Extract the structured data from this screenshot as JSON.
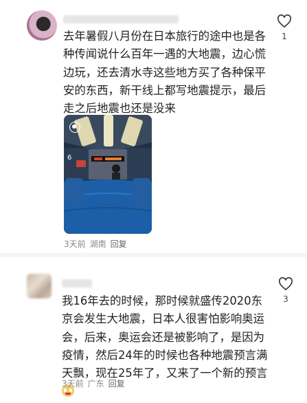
{
  "comments": [
    {
      "text": "去年暑假八月份在日本旅行的途中也是各种传闻说什么百年一遇的大地震，边心慌边玩，还去清水寺这些地方买了各种保平安的东西，新干线上都写地震提示，最后走之后地震也还是没来",
      "time": "3天前",
      "location": "湖南",
      "reply": "回复",
      "likes": "1",
      "photo_sign": "6"
    },
    {
      "text": "我16年去的时候，那时候就盛传2020东京会发生大地震，日本人很害怕影响奥运会，后来，奥运会还是被影响了，是因为疫情，然后24年的时候也各种地震预言满天飘，现在25年了，又来了一个新的预言",
      "time": "3天前",
      "location": "广东",
      "reply": "回复",
      "likes": "3"
    }
  ],
  "icons": {
    "like": "heart-outline-icon",
    "live": "live-photo-icon",
    "emoji": "crying-laughing-emoji"
  }
}
